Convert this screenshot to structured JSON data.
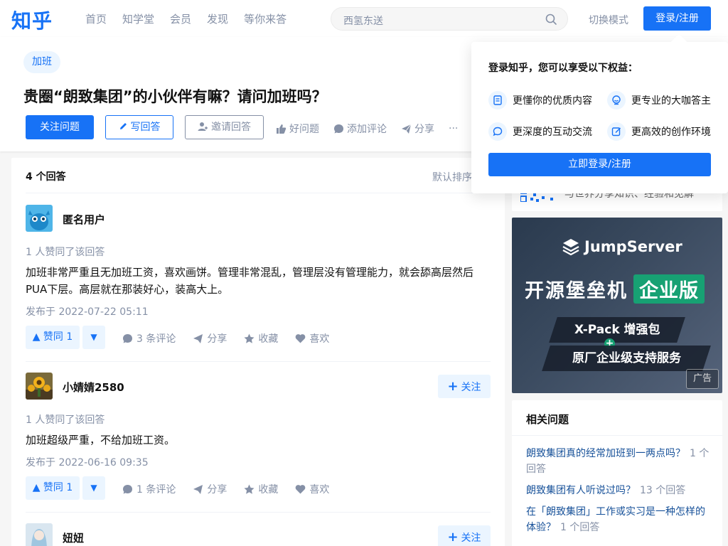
{
  "colors": {
    "brand": "#1772f6",
    "muted": "#8590a6",
    "link": "#175199"
  },
  "header": {
    "logo": "知乎",
    "nav": [
      "首页",
      "知学堂",
      "会员",
      "发现",
      "等你来答"
    ],
    "search_placeholder": "西氢东送",
    "mode_switch": "切换模式",
    "login": "登录/注册"
  },
  "question": {
    "topic": "加班",
    "title": "贵圈“朗致集团”的小伙伴有嘛？请问加班吗？",
    "follow": "关注问题",
    "write": "写回答",
    "invite": "邀请回答",
    "good_q": "好问题",
    "comment": "添加评论",
    "share": "分享",
    "more": "···"
  },
  "answers_panel": {
    "count": "4 个回答",
    "sort": "默认排序"
  },
  "answers": [
    {
      "author": "匿名用户",
      "agree": "1 人赞同了该回答",
      "content": "加班非常严重且无加班工资，喜欢画饼。管理非常混乱，管理层没有管理能力，就会舔高层然后PUA下层。高层就在那装好心，装高大上。",
      "date": "发布于 2022-07-22 05:11",
      "vote": "赞同 1",
      "comments": "3 条评论",
      "share": "分享",
      "collect": "收藏",
      "like": "喜欢"
    },
    {
      "author": "小婧婧2580",
      "follow": "关注",
      "agree": "1 人赞同了该回答",
      "content": "加班超级严重，不给加班工资。",
      "date": "发布于 2022-06-16 09:35",
      "vote": "赞同 1",
      "comments": "1 条评论",
      "share": "分享",
      "collect": "收藏",
      "like": "喜欢"
    },
    {
      "author": "妞妞",
      "follow": "关注"
    }
  ],
  "sidebar": {
    "qr_text": "与世界分享知识、经验和见解",
    "ad": {
      "brand": "JumpServer",
      "headline": "开源堡垒机",
      "edition": "企业版",
      "line1": "X-Pack 增强包",
      "line2": "原厂企业级支持服务",
      "label": "广告"
    },
    "related_title": "相关问题",
    "related": [
      {
        "q": "朗致集团真的经常加班到一两点吗？",
        "count": "1 个回答"
      },
      {
        "q": "朗致集团有人听说过吗？",
        "count": "13 个回答"
      },
      {
        "q": "在「朗致集团」工作或实习是一种怎样的体验？",
        "count": "1 个回答"
      }
    ]
  },
  "login_popup": {
    "title": "登录知乎，您可以享受以下权益：",
    "benefits": [
      "更懂你的优质内容",
      "更专业的大咖答主",
      "更深度的互动交流",
      "更高效的创作环境"
    ],
    "button": "立即登录/注册"
  }
}
